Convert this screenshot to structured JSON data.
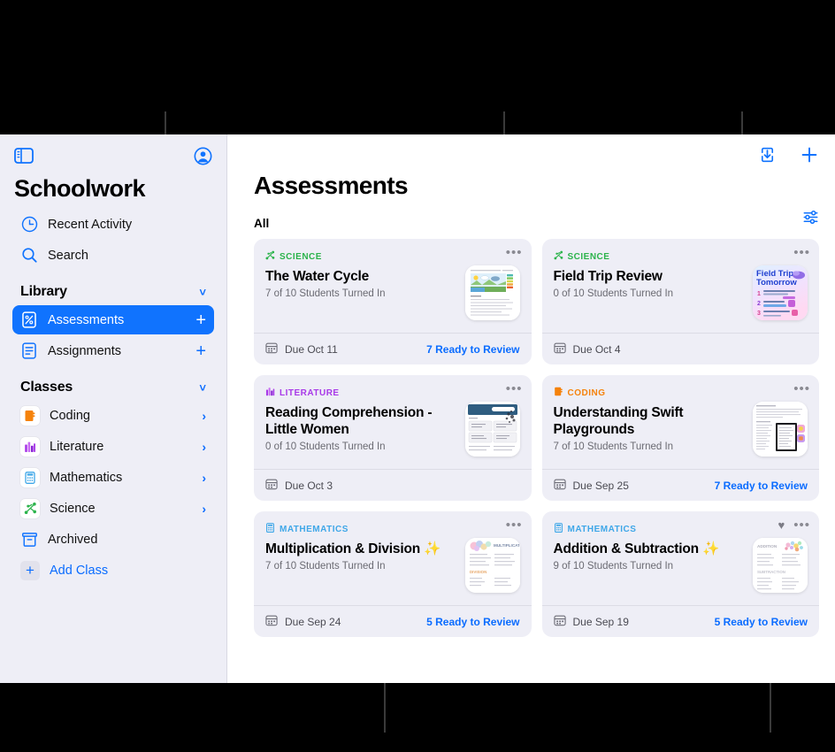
{
  "sidebar": {
    "app_title": "Schoolwork",
    "toggle_icon": "sidebar-toggle-icon",
    "account_icon": "account-circle-icon",
    "quick_items": [
      {
        "label": "Recent Activity",
        "icon": "clock-icon"
      },
      {
        "label": "Search",
        "icon": "search-icon"
      }
    ],
    "library": {
      "title": "Library",
      "items": [
        {
          "label": "Assessments",
          "icon": "assessment-icon",
          "active": true,
          "action": "+"
        },
        {
          "label": "Assignments",
          "icon": "assignment-icon",
          "active": false,
          "action": "+"
        }
      ]
    },
    "classes": {
      "title": "Classes",
      "items": [
        {
          "label": "Coding",
          "icon": "coding-icon",
          "color": "#F5820B",
          "chevron": "›"
        },
        {
          "label": "Literature",
          "icon": "literature-icon",
          "color": "#A839E8",
          "chevron": "›"
        },
        {
          "label": "Mathematics",
          "icon": "mathematics-icon",
          "color": "#3FA7E8",
          "chevron": "›"
        },
        {
          "label": "Science",
          "icon": "science-icon",
          "color": "#2BB34B",
          "chevron": "›"
        }
      ],
      "archived": {
        "label": "Archived",
        "icon": "archive-box-icon"
      },
      "add_class": {
        "label": "Add Class",
        "icon": "plus-icon"
      }
    }
  },
  "main": {
    "title": "Assessments",
    "subhead": "All",
    "toolbar": [
      {
        "name": "import-button",
        "icon": "import-download-icon"
      },
      {
        "name": "add-button",
        "icon": "plus-icon"
      }
    ],
    "filter_button": {
      "name": "filter-button",
      "icon": "sliders-filter-icon"
    },
    "cards": [
      {
        "subject": "SCIENCE",
        "subject_color": "#2BB34B",
        "subject_icon": "science-icon",
        "title": "The Water Cycle",
        "status": "7 of 10 Students Turned In",
        "due": "Due Oct 11",
        "review": "7 Ready to Review",
        "favorite": false,
        "thumb": "water-cycle-worksheet"
      },
      {
        "subject": "SCIENCE",
        "subject_color": "#2BB34B",
        "subject_icon": "science-icon",
        "title": "Field Trip Review",
        "status": "0 of 10 Students Turned In",
        "due": "Due Oct 4",
        "review": "",
        "favorite": false,
        "thumb": "field-trip-poster"
      },
      {
        "subject": "LITERATURE",
        "subject_color": "#A839E8",
        "subject_icon": "literature-icon",
        "title": "Reading Comprehension - Little Women",
        "status": "0 of 10 Students Turned In",
        "due": "Due Oct 3",
        "review": "",
        "favorite": false,
        "thumb": "reading-worksheet"
      },
      {
        "subject": "CODING",
        "subject_color": "#F5820B",
        "subject_icon": "coding-icon",
        "title": "Understanding Swift Playgrounds",
        "status": "7 of 10 Students Turned In",
        "due": "Due Sep 25",
        "review": "7 Ready to Review",
        "favorite": false,
        "thumb": "swift-playgrounds-doc"
      },
      {
        "subject": "MATHEMATICS",
        "subject_color": "#3FA7E8",
        "subject_icon": "mathematics-icon",
        "title": "Multiplication & Division ✨",
        "status": "7 of 10 Students Turned In",
        "due": "Due Sep 24",
        "review": "5 Ready to Review",
        "favorite": false,
        "thumb": "multiplication-worksheet"
      },
      {
        "subject": "MATHEMATICS",
        "subject_color": "#3FA7E8",
        "subject_icon": "mathematics-icon",
        "title": "Addition & Subtraction ✨",
        "status": "9 of 10 Students Turned In",
        "due": "Due Sep 19",
        "review": "5 Ready to Review",
        "favorite": true,
        "thumb": "addition-worksheet"
      }
    ]
  },
  "colors": {
    "accent": "#0a6cff",
    "sidebar_bg": "#eeeef6",
    "card_bg": "#eeeef6",
    "active_row": "#1073fe"
  }
}
